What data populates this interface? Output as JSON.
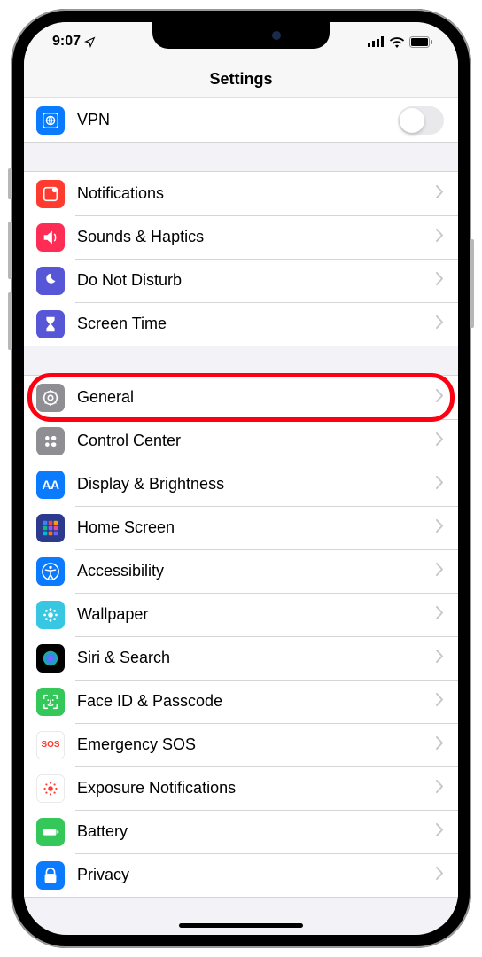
{
  "statusBar": {
    "time": "9:07",
    "locArrow": "➤"
  },
  "header": {
    "title": "Settings"
  },
  "groups": [
    {
      "rows": [
        {
          "id": "vpn",
          "label": "VPN",
          "bg": "#0a7aff",
          "hasToggle": true
        }
      ]
    },
    {
      "rows": [
        {
          "id": "notifications",
          "label": "Notifications",
          "bg": "#ff3b30"
        },
        {
          "id": "sounds",
          "label": "Sounds & Haptics",
          "bg": "#ff2d55"
        },
        {
          "id": "dnd",
          "label": "Do Not Disturb",
          "bg": "#5756d6"
        },
        {
          "id": "screentime",
          "label": "Screen Time",
          "bg": "#5756d6"
        }
      ]
    },
    {
      "rows": [
        {
          "id": "general",
          "label": "General",
          "bg": "#8e8e93",
          "highlighted": true
        },
        {
          "id": "controlcenter",
          "label": "Control Center",
          "bg": "#8e8e93"
        },
        {
          "id": "display",
          "label": "Display & Brightness",
          "bg": "#0a7aff"
        },
        {
          "id": "homescreen",
          "label": "Home Screen",
          "bg": "#2b3a8c"
        },
        {
          "id": "accessibility",
          "label": "Accessibility",
          "bg": "#0a7aff"
        },
        {
          "id": "wallpaper",
          "label": "Wallpaper",
          "bg": "#37c7e2"
        },
        {
          "id": "siri",
          "label": "Siri & Search",
          "bg": "#000"
        },
        {
          "id": "faceid",
          "label": "Face ID & Passcode",
          "bg": "#34c759"
        },
        {
          "id": "sos",
          "label": "Emergency SOS",
          "bg": "#fff",
          "textIcon": "SOS",
          "textIconColor": "#ff3b30"
        },
        {
          "id": "exposure",
          "label": "Exposure Notifications",
          "bg": "#fff"
        },
        {
          "id": "battery",
          "label": "Battery",
          "bg": "#34c759"
        },
        {
          "id": "privacy",
          "label": "Privacy",
          "bg": "#0a7aff"
        }
      ]
    }
  ]
}
